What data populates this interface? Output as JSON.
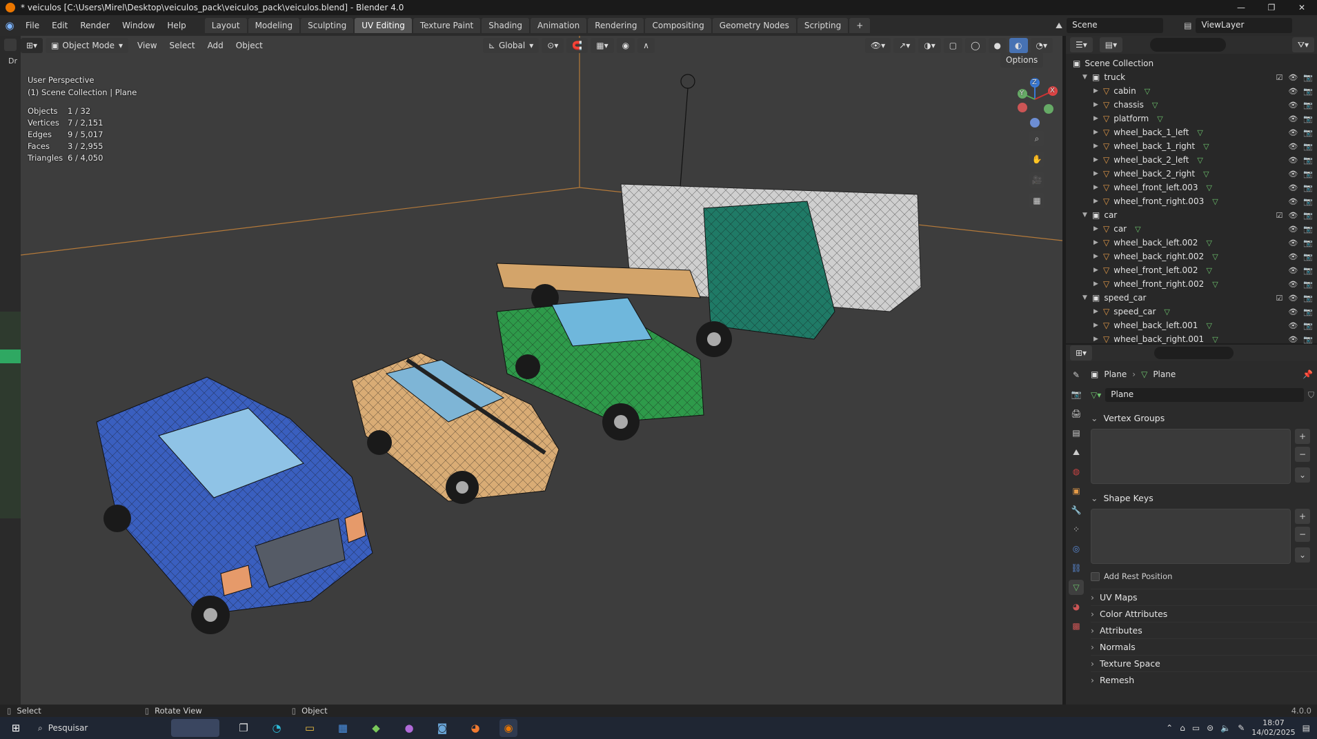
{
  "window": {
    "title": "* veiculos [C:\\Users\\Mirel\\Desktop\\veiculos_pack\\veiculos_pack\\veiculos.blend] - Blender 4.0",
    "min": "—",
    "max": "❐",
    "close": "✕"
  },
  "menu": [
    "File",
    "Edit",
    "Render",
    "Window",
    "Help"
  ],
  "workspaces": [
    "Layout",
    "Modeling",
    "Sculpting",
    "UV Editing",
    "Texture Paint",
    "Shading",
    "Animation",
    "Rendering",
    "Compositing",
    "Geometry Nodes",
    "Scripting"
  ],
  "active_workspace": "UV Editing",
  "add_workspace": "+",
  "scene": {
    "label": "Scene",
    "view_layer": "ViewLayer"
  },
  "viewport": {
    "mode": "Object Mode",
    "menus": [
      "View",
      "Select",
      "Add",
      "Object"
    ],
    "transform": "Global",
    "options": "Options",
    "perspective": "User Perspective",
    "context": "(1) Scene Collection | Plane",
    "stats": [
      {
        "label": "Objects",
        "value": "1 / 32"
      },
      {
        "label": "Vertices",
        "value": "7 / 2,151"
      },
      {
        "label": "Edges",
        "value": "9 / 5,017"
      },
      {
        "label": "Faces",
        "value": "3 / 2,955"
      },
      {
        "label": "Triangles",
        "value": "6 / 4,050"
      }
    ],
    "gizmo": {
      "x": "X",
      "y": "Y",
      "z": "Z"
    },
    "left_label": "Dr"
  },
  "outliner": {
    "root": "Scene Collection",
    "collections": [
      {
        "name": "truck",
        "items": [
          "cabin",
          "chassis",
          "platform",
          "wheel_back_1_left",
          "wheel_back_1_right",
          "wheel_back_2_left",
          "wheel_back_2_right",
          "wheel_front_left.003",
          "wheel_front_right.003"
        ]
      },
      {
        "name": "car",
        "items": [
          "car",
          "wheel_back_left.002",
          "wheel_back_right.002",
          "wheel_front_left.002",
          "wheel_front_right.002"
        ]
      },
      {
        "name": "speed_car",
        "items": [
          "speed_car",
          "wheel_back_left.001",
          "wheel_back_right.001"
        ]
      }
    ]
  },
  "properties": {
    "breadcrumb_object": "Plane",
    "breadcrumb_data": "Plane",
    "data_name": "Plane",
    "panels_open": [
      "Vertex Groups",
      "Shape Keys"
    ],
    "add_rest_position": "Add Rest Position",
    "panels_closed": [
      "UV Maps",
      "Color Attributes",
      "Attributes",
      "Normals",
      "Texture Space",
      "Remesh"
    ]
  },
  "status": {
    "select": "Select",
    "rotate": "Rotate View",
    "object": "Object",
    "version": "4.0.0"
  },
  "taskbar": {
    "search": "Pesquisar",
    "time": "18:07",
    "date": "14/02/2025"
  },
  "colors": {
    "accent": "#ea7600",
    "viewport_bg": "#3d3d3d",
    "active_tab": "#545454",
    "mesh_icon": "#6ec56e",
    "object_icon": "#e39a48"
  }
}
